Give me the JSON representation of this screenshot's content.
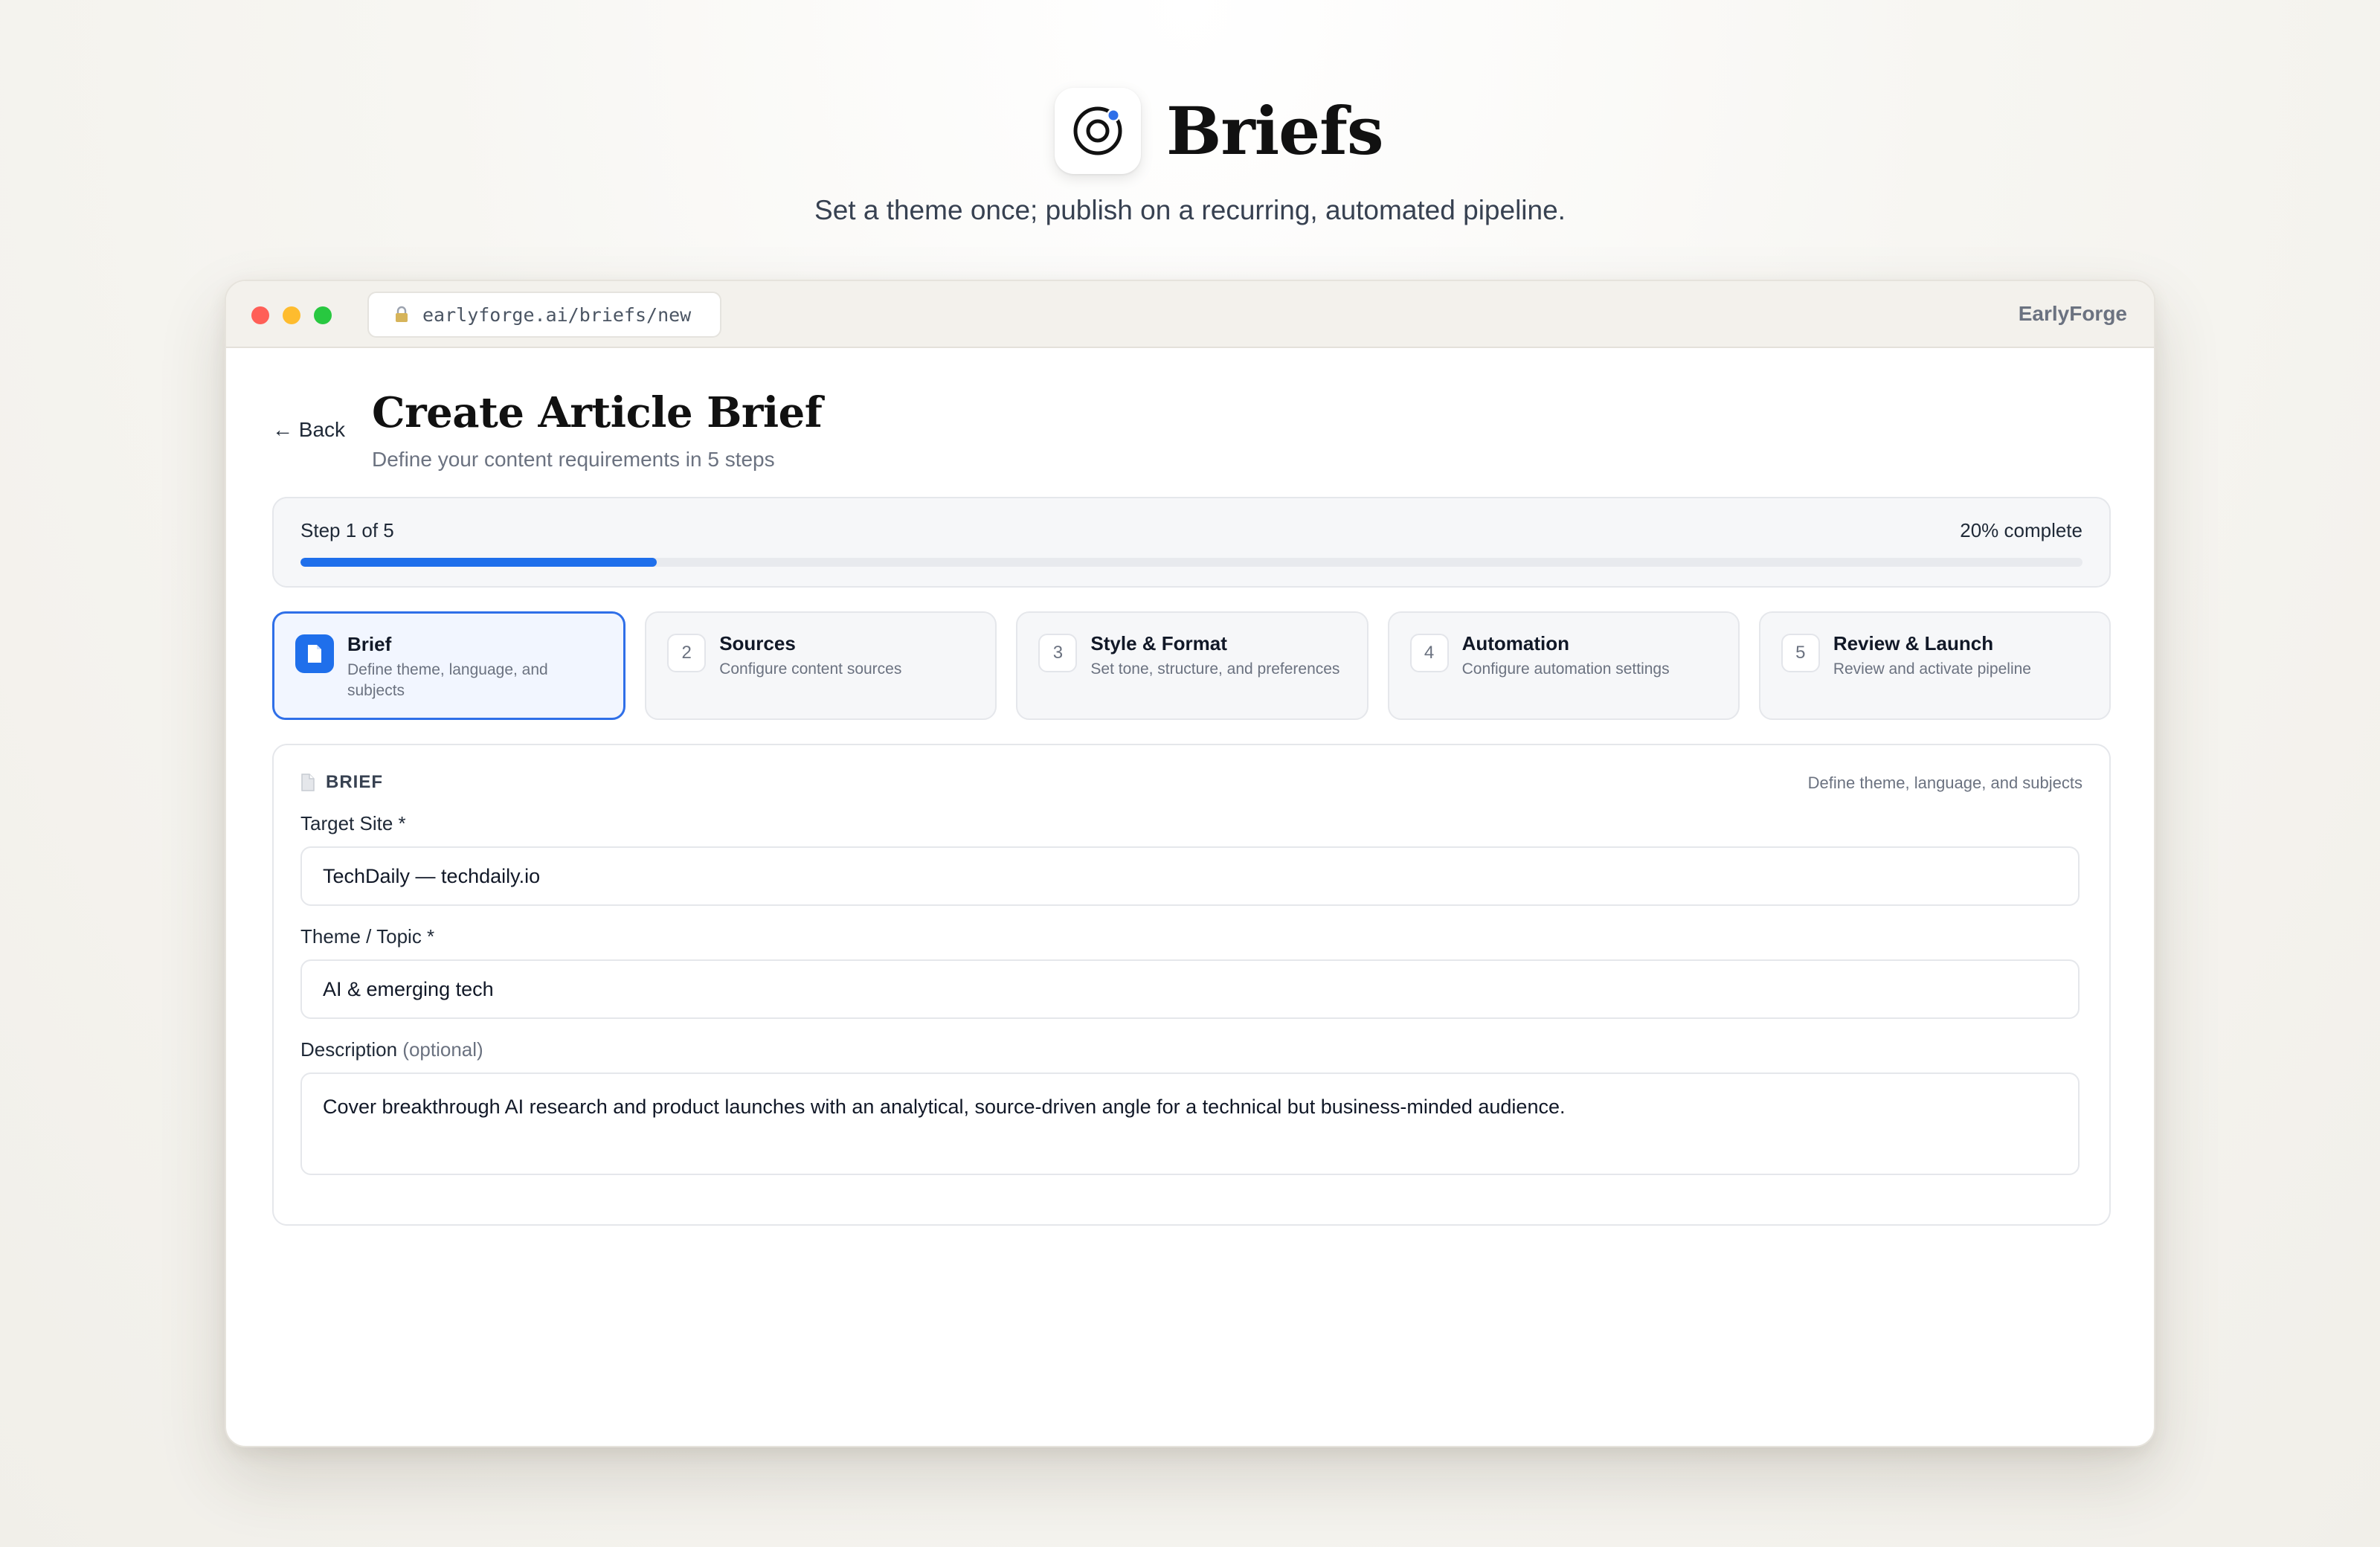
{
  "hero": {
    "title": "Briefs",
    "subtitle": "Set a theme once; publish on a recurring, automated pipeline."
  },
  "window": {
    "url": "earlyforge.ai/briefs/new",
    "brand": "EarlyForge",
    "traffic_colors": [
      "#ff5f57",
      "#febc2e",
      "#28c840"
    ]
  },
  "page": {
    "back_label": "← Back",
    "title": "Create Article Brief",
    "subtitle": "Define your content requirements in 5 steps"
  },
  "progress": {
    "step_label": "Step 1 of 5",
    "percent_label": "20% complete",
    "fraction": 0.2
  },
  "steps": [
    {
      "num": "1",
      "title": "Brief",
      "desc": "Define theme, language, and subjects",
      "active": true
    },
    {
      "num": "2",
      "title": "Sources",
      "desc": "Configure content sources",
      "active": false
    },
    {
      "num": "3",
      "title": "Style & Format",
      "desc": "Set tone, structure, and preferences",
      "active": false
    },
    {
      "num": "4",
      "title": "Automation",
      "desc": "Configure automation settings",
      "active": false
    },
    {
      "num": "5",
      "title": "Review & Launch",
      "desc": "Review and activate pipeline",
      "active": false
    }
  ],
  "form": {
    "section_label": "BRIEF",
    "section_hint": "Define theme, language, and subjects",
    "target_site": {
      "label": "Target Site *",
      "value": "TechDaily — techdaily.io"
    },
    "theme": {
      "label": "Theme / Topic *",
      "value": "AI & emerging tech"
    },
    "description": {
      "label": "Description",
      "optional": "(optional)",
      "value": "Cover breakthrough AI research and product launches with an analytical, source-driven angle for a technical but business-minded audience."
    }
  },
  "colors": {
    "accent": "#1f6feb",
    "icon_dot": "#2f6fe8"
  }
}
